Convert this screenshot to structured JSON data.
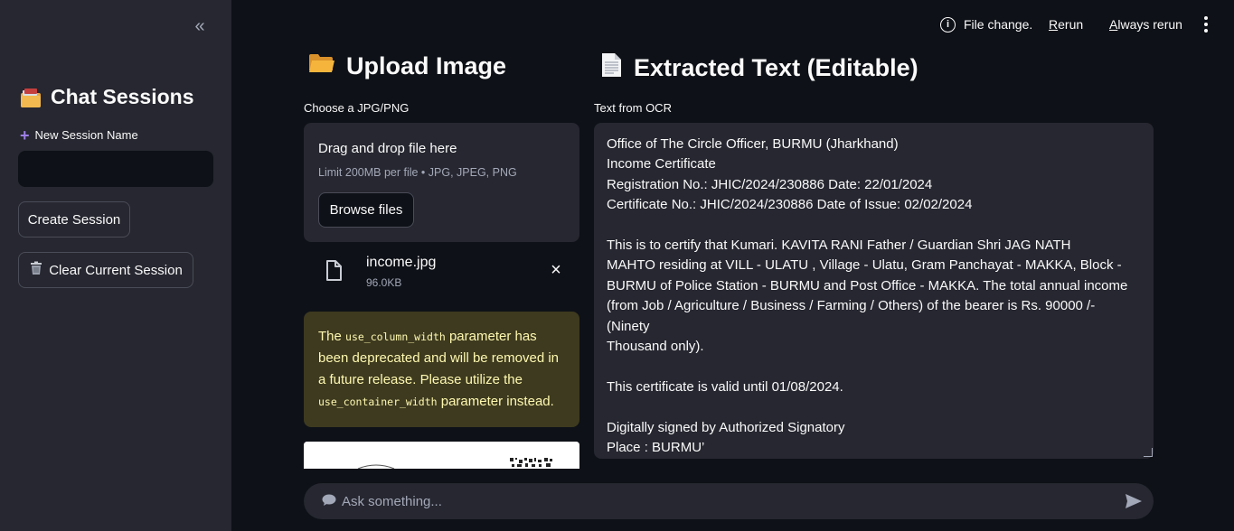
{
  "sidebar": {
    "collapse_icon": "«",
    "title": "Chat Sessions",
    "title_icon": "card-index-dividers-icon",
    "new_session_label": "New Session Name",
    "new_session_value": "",
    "create_button": "Create Session",
    "clear_button": "Clear Current Session"
  },
  "topbar": {
    "status": "File change.",
    "rerun": "Rerun",
    "always_rerun": "Always rerun"
  },
  "upload": {
    "heading": "Upload Image",
    "label": "Choose a JPG/PNG",
    "drop_title": "Drag and drop file here",
    "drop_limit": "Limit 200MB per file • JPG, JPEG, PNG",
    "browse_button": "Browse files",
    "file_name": "income.jpg",
    "file_size": "96.0KB"
  },
  "warning": {
    "p1": "The ",
    "code1": "use_column_width",
    "p2": " parameter has been deprecated and will be removed in a future release. Please utilize the ",
    "code2": "use_container_width",
    "p3": " parameter instead."
  },
  "extracted": {
    "heading": "Extracted Text (Editable)",
    "label": "Text from OCR",
    "text": "Office of The Circle Officer, BURMU (Jharkhand)\nIncome Certificate\nRegistration No.: JHIC/2024/230886 Date: 22/01/2024\nCertificate No.: JHIC/2024/230886 Date of Issue: 02/02/2024\n\nThis is to certify that Kumari. KAVITA RANI Father / Guardian Shri JAG NATH\nMAHTO residing at VILL - ULATU , Village - Ulatu, Gram Panchayat - MAKKA, Block -\nBURMU of Police Station - BURMU and Post Office - MAKKA. The total annual income\n(from Job / Agriculture / Business / Farming / Others) of the bearer is Rs. 90000 /-\n(Ninety\nThousand only).\n\nThis certificate is valid until 01/08/2024.\n\nDigitally signed by Authorized Signatory\nPlace : BURMU’"
  },
  "chat": {
    "placeholder": "Ask something..."
  },
  "colors": {
    "app_bg": "#0e1117",
    "sidebar_bg": "#262730",
    "warning_bg": "#3d3a1f",
    "warning_text": "#fff8b0",
    "accent_purple": "#9d7fe6"
  }
}
